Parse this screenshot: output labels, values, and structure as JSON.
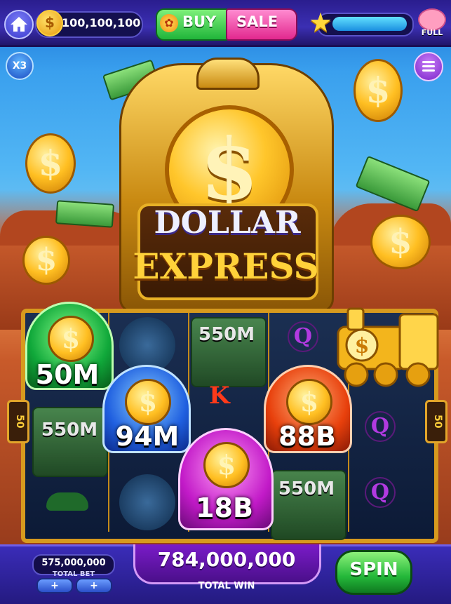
{
  "top_bar": {
    "coin_balance": "100,100,100",
    "buy_label": "BUY",
    "sale_label": "SALE",
    "piggy_label": "FULL",
    "xp_progress": 0.95
  },
  "multiplier_label": "X3",
  "game_logo": {
    "line1": "DOLLAR",
    "line2": "EXPRESS"
  },
  "reel_side_label": "50",
  "reels": {
    "cash_values": [
      "550M",
      "550M",
      "550M"
    ],
    "symbols": [
      "Q",
      "K",
      "Q",
      "Q"
    ]
  },
  "bonus_trains": [
    {
      "color": "green",
      "value": "50M"
    },
    {
      "color": "blue",
      "value": "94M"
    },
    {
      "color": "red",
      "value": "88B"
    },
    {
      "color": "purple",
      "value": "18B"
    },
    {
      "color": "gold",
      "value": ""
    }
  ],
  "bottom_bar": {
    "total_bet_value": "575,000,000",
    "total_bet_label": "TOTAL BET",
    "total_win_value": "784,000,000",
    "total_win_label": "TOTAL WIN",
    "spin_label": "SPIN",
    "plus_label": "+"
  },
  "colors": {
    "accent_gold": "#ffd23a",
    "buy_green": "#20b53a",
    "sale_pink": "#e2288e",
    "spin_green": "#24b83a"
  }
}
